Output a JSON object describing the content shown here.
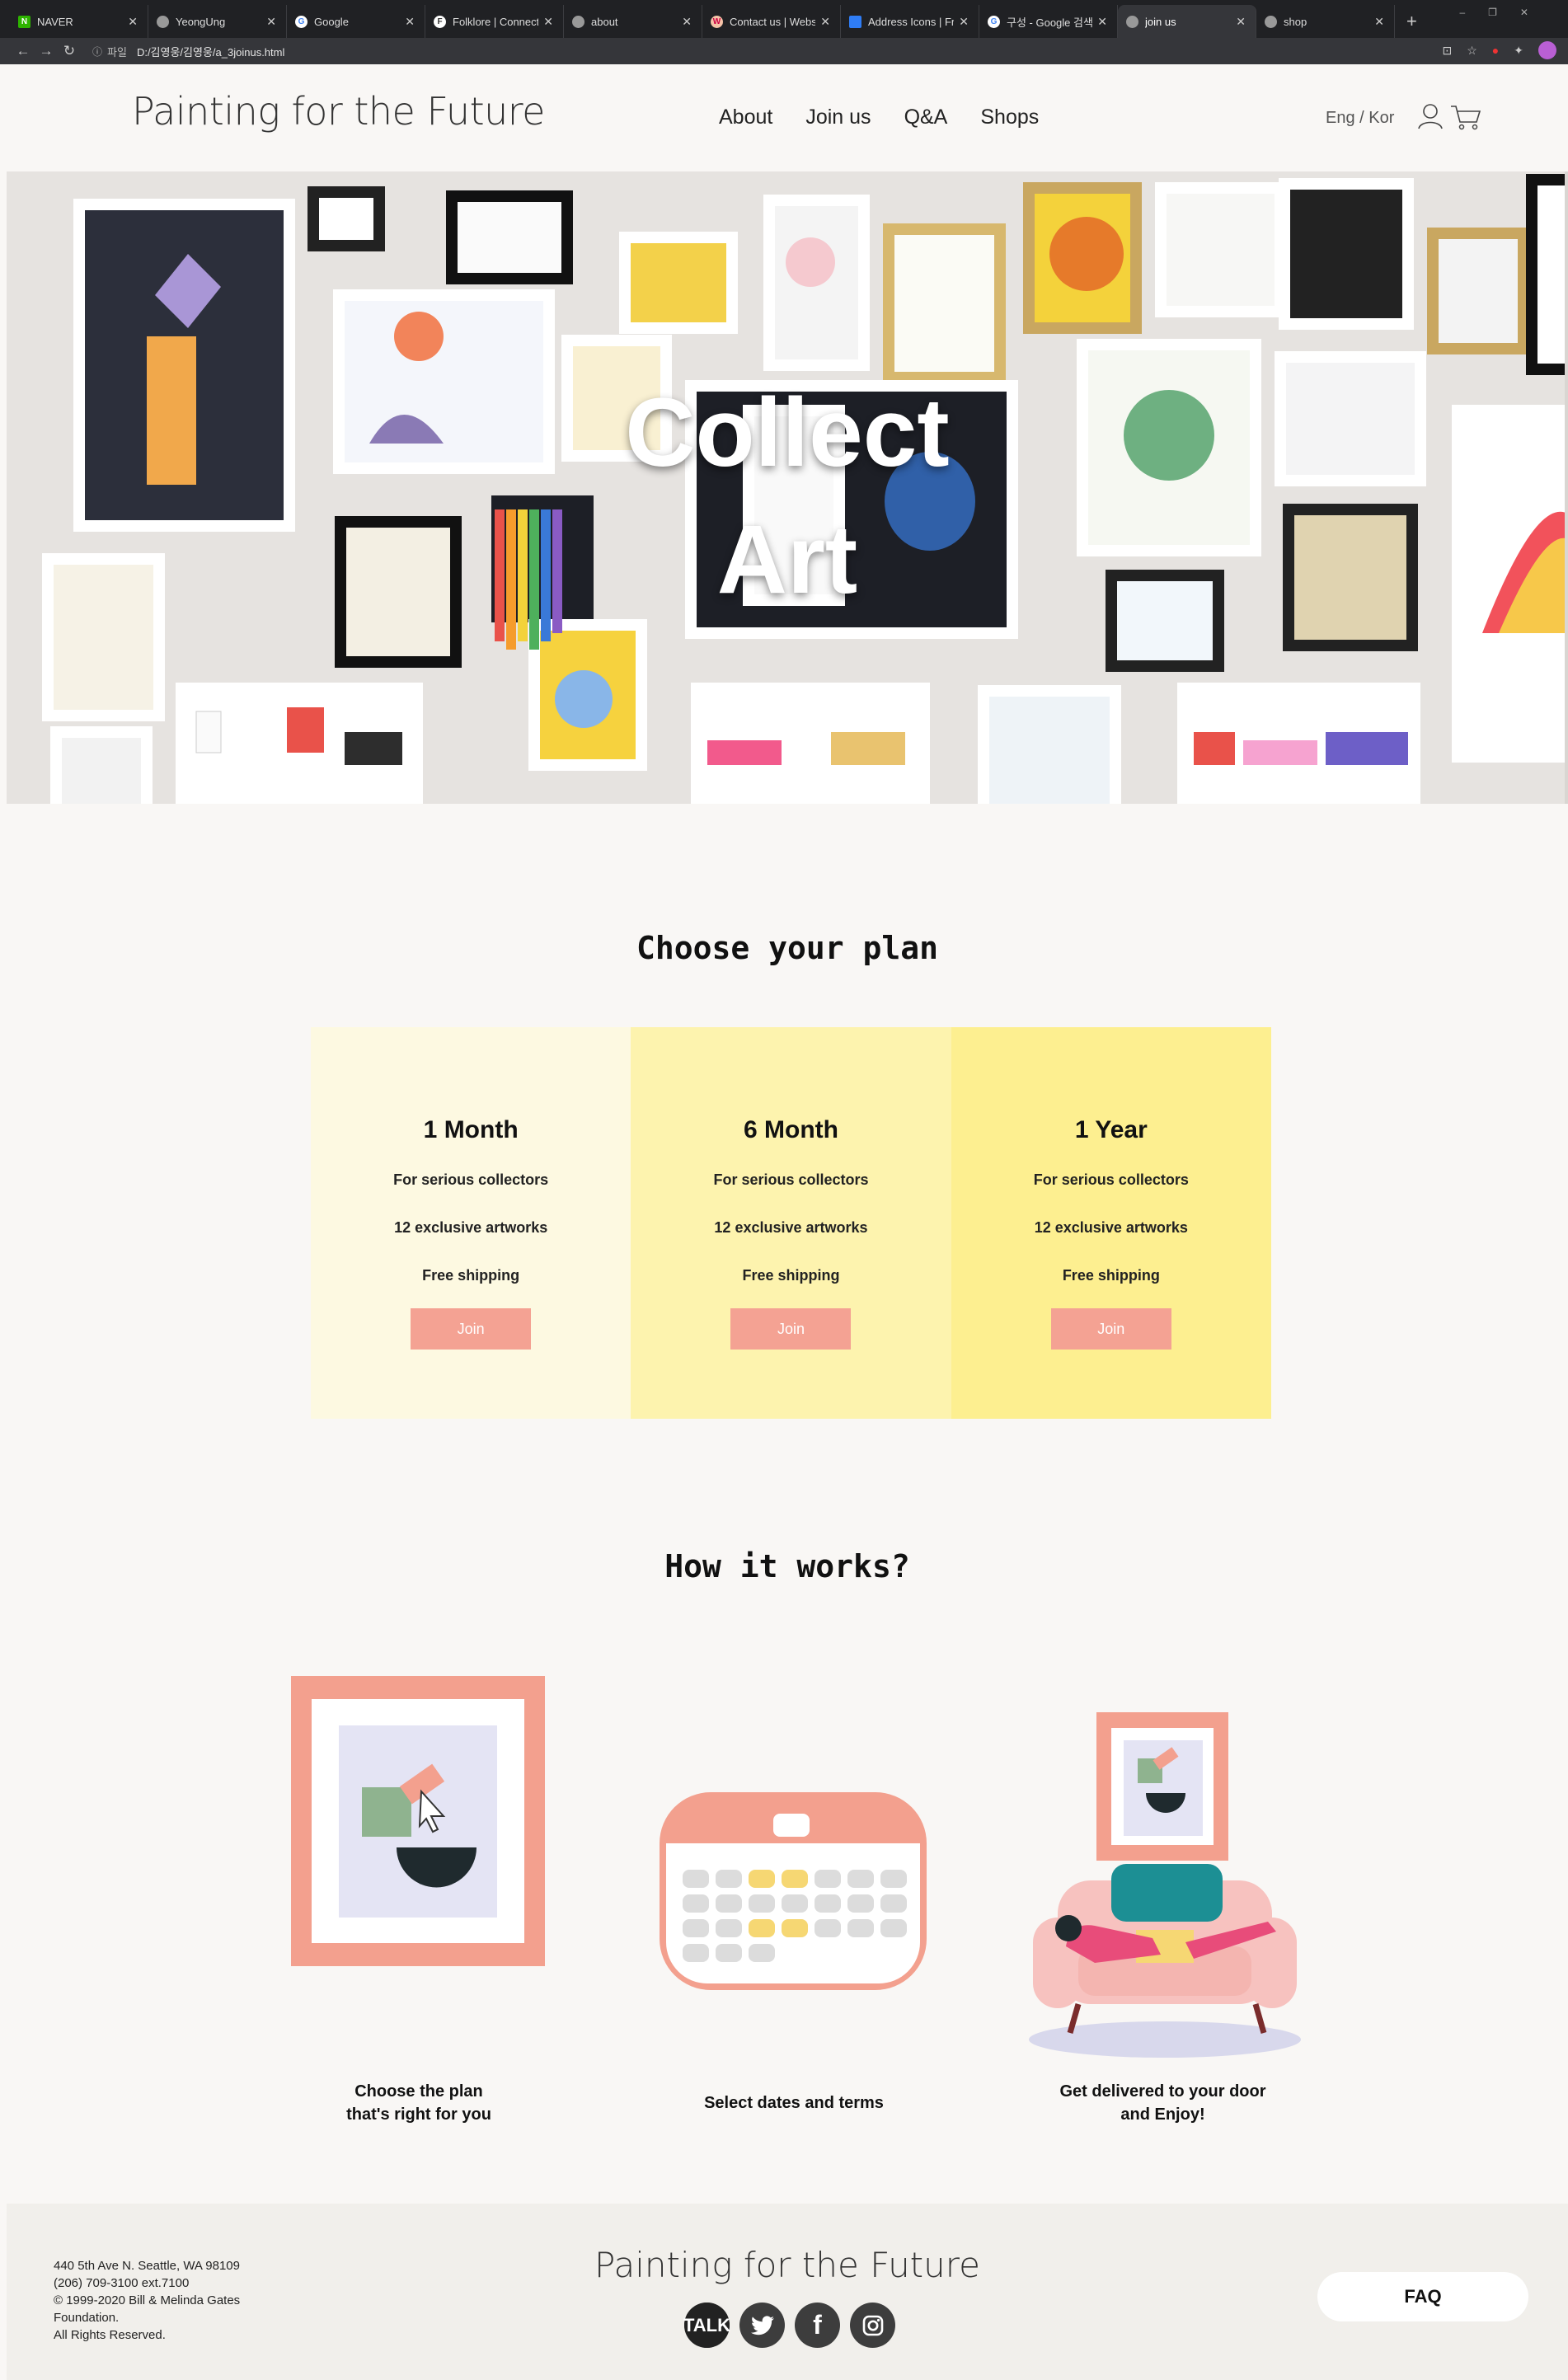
{
  "browser": {
    "tabs": [
      {
        "label": "NAVER",
        "icon": "naver-icon",
        "active": false
      },
      {
        "label": "YeongUng",
        "icon": "globe-icon",
        "active": false
      },
      {
        "label": "Google",
        "icon": "google-icon",
        "active": false
      },
      {
        "label": "Folklore | Connect",
        "icon": "folklore-icon",
        "active": false
      },
      {
        "label": "about",
        "icon": "globe-icon",
        "active": false
      },
      {
        "label": "Contact us | Webs",
        "icon": "contact-icon",
        "active": false
      },
      {
        "label": "Address Icons | Fr",
        "icon": "address-icon",
        "active": false
      },
      {
        "label": "구성 - Google 검색",
        "icon": "google-icon",
        "active": false
      },
      {
        "label": "join us",
        "icon": "globe-icon",
        "active": true
      },
      {
        "label": "shop",
        "icon": "globe-icon",
        "active": false
      }
    ],
    "url_scheme": "파일",
    "url": "D:/김영웅/김영웅/a_3joinus.html"
  },
  "header": {
    "logo": "Painting for the Future",
    "nav": [
      "About",
      "Join us",
      "Q&A",
      "Shops"
    ],
    "lang": "Eng / Kor"
  },
  "hero": {
    "title_line1": "Collect",
    "title_line2": "Art"
  },
  "plans": {
    "title": "Choose your plan",
    "items": [
      {
        "name": "1 Month",
        "features": [
          "For serious collectors",
          "12 exclusive artworks",
          "Free shipping"
        ],
        "button": "Join"
      },
      {
        "name": "6 Month",
        "features": [
          "For serious collectors",
          "12 exclusive artworks",
          "Free shipping"
        ],
        "button": "Join"
      },
      {
        "name": "1 Year",
        "features": [
          "For serious collectors",
          "12 exclusive artworks",
          "Free shipping"
        ],
        "button": "Join"
      }
    ],
    "colors": [
      "#fdf9e1",
      "#fdf3ae",
      "#fdef90"
    ],
    "button_color": "#f4a293"
  },
  "how": {
    "title": "How it works?",
    "steps": [
      {
        "line1": "Choose the plan",
        "line2": "that's right for you"
      },
      {
        "line1": "Select dates and terms",
        "line2": ""
      },
      {
        "line1": "Get delivered to your door",
        "line2": "and Enjoy!"
      }
    ]
  },
  "footer": {
    "address": [
      "440 5th Ave N. Seattle, WA 98109",
      "(206) 709-3100 ext.7100",
      "© 1999-2020 Bill & Melinda Gates",
      "Foundation.",
      "All Rights Reserved."
    ],
    "logo": "Painting for the Future",
    "social": [
      "kakaotalk-icon",
      "twitter-icon",
      "facebook-icon",
      "instagram-icon"
    ],
    "kakao_label": "TALK",
    "faq": "FAQ"
  }
}
